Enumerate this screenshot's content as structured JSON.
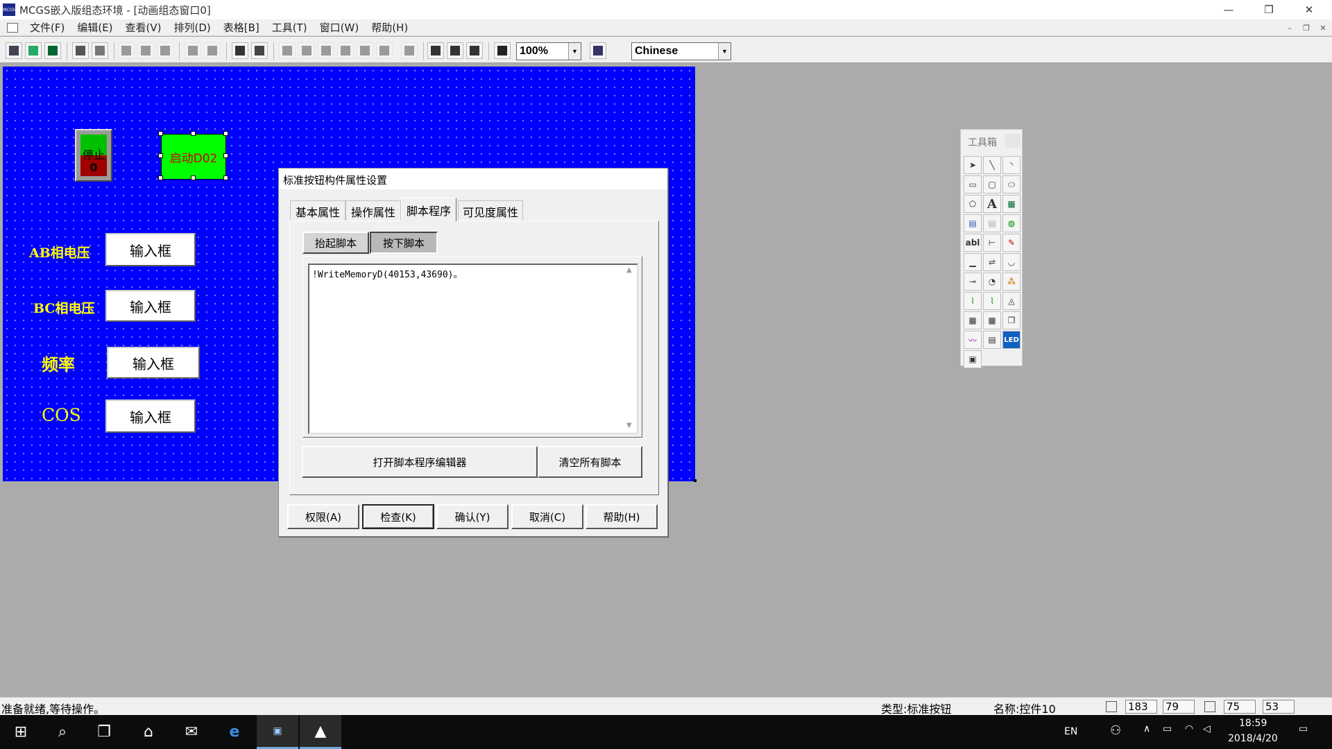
{
  "window": {
    "title": "MCGS嵌入版组态环境 - [动画组态窗口0]",
    "app_icon_text": "MCGS"
  },
  "menubar": {
    "items": [
      "文件(F)",
      "编辑(E)",
      "查看(V)",
      "排列(D)",
      "表格[B]",
      "工具(T)",
      "窗口(W)",
      "帮助(H)"
    ]
  },
  "toolbar": {
    "zoom": "100%",
    "language": "Chinese"
  },
  "canvas": {
    "background": "#0000ff",
    "stop_button": {
      "label": "停止",
      "value": "0"
    },
    "start_button": {
      "label": "启动D02"
    },
    "rows": [
      {
        "label": "AB相电压",
        "input": "输入框"
      },
      {
        "label": "BC相电压",
        "input": "输入框"
      },
      {
        "label": "频率",
        "input": "输入框"
      },
      {
        "label": "COS",
        "input": "输入框"
      }
    ]
  },
  "toolbox": {
    "title": "工具箱",
    "text_tool": "A",
    "label_tool": "abl",
    "led_tool": "LED"
  },
  "dialog": {
    "title": "标准按钮构件属性设置",
    "tabs": [
      "基本属性",
      "操作属性",
      "脚本程序",
      "可见度属性"
    ],
    "active_tab": "脚本程序",
    "subtabs": [
      "抬起脚本",
      "按下脚本"
    ],
    "script": "!WriteMemoryD(40153,43690)。",
    "open_editor": "打开脚本程序编辑器",
    "clear_scripts": "清空所有脚本",
    "buttons": [
      "权限(A)",
      "检查(K)",
      "确认(Y)",
      "取消(C)",
      "帮助(H)"
    ]
  },
  "statusbar": {
    "message": "准备就绪,等待操作。",
    "type": "类型:标准按钮",
    "name": "名称:控件10",
    "x": "183",
    "y": "79",
    "w": "75",
    "h": "53"
  },
  "taskbar": {
    "lang": "EN",
    "time": "18:59",
    "date": "2018/4/20"
  }
}
